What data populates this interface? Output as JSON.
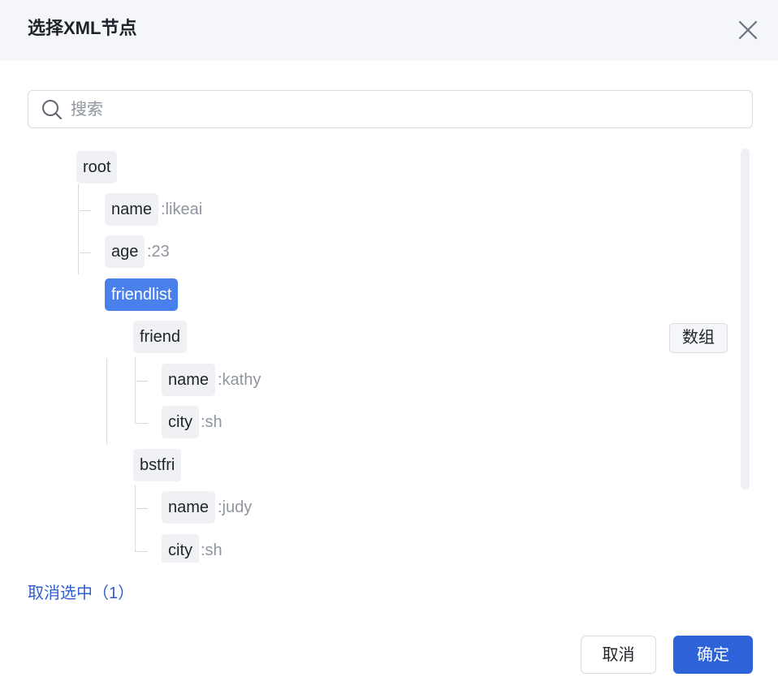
{
  "dialog": {
    "title": "选择XML节点",
    "close_icon": "close-icon"
  },
  "search": {
    "placeholder": "搜索",
    "value": "",
    "icon": "search-icon"
  },
  "tree": {
    "root": {
      "label": "root"
    },
    "root_name": {
      "label": "name",
      "value": ":likeai"
    },
    "root_age": {
      "label": "age",
      "value": ":23"
    },
    "friendlist": {
      "label": "friendlist",
      "selected": true
    },
    "friend": {
      "label": "friend",
      "badge": "数组"
    },
    "friend_name": {
      "label": "name",
      "value": ":kathy"
    },
    "friend_city": {
      "label": "city",
      "value": ":sh"
    },
    "bstfri": {
      "label": "bstfri"
    },
    "bstfri_name": {
      "label": "name",
      "value": ":judy"
    },
    "bstfri_city": {
      "label": "city",
      "value": ":sh"
    }
  },
  "footer": {
    "deselect_label": "取消选中（1）",
    "cancel_label": "取消",
    "ok_label": "确定"
  },
  "colors": {
    "selected_node": "#4a80ec",
    "primary_button": "#2e62d9",
    "link": "#2e5fcf"
  }
}
